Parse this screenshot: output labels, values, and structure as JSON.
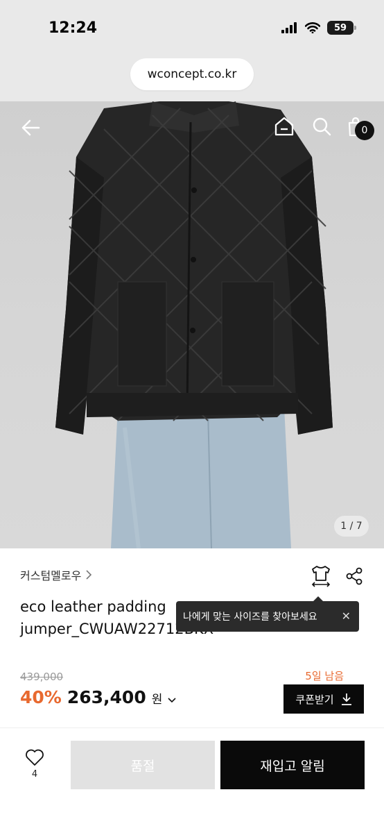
{
  "status_bar": {
    "time": "12:24",
    "battery": "59",
    "icons": [
      "signal-icon",
      "wifi-icon",
      "battery-icon"
    ]
  },
  "browser": {
    "url": "wconcept.co.kr"
  },
  "hero": {
    "image_counter": "1 / 7",
    "cart_count": "0",
    "nav_icons": [
      "back-arrow-icon",
      "home-icon",
      "search-icon",
      "shopping-bag-icon"
    ]
  },
  "product": {
    "brand": "커스텀멜로우",
    "name": "eco leather padding jumper_CWUAW22712BKX",
    "original_price": "439,000",
    "discount": "40%",
    "price": "263,400",
    "currency": "원",
    "days_left": "5일 남음",
    "coupon_label": "쿠폰받기"
  },
  "tooltip": {
    "text": "나에게 맞는 사이즈를 찾아보세요"
  },
  "actions": {
    "like_count": "4",
    "soldout_label": "품절",
    "restock_label": "재입고 알림"
  },
  "colors": {
    "accent": "#e8692f",
    "dark": "#0a0a0a",
    "disabled": "#e2e2e2"
  }
}
